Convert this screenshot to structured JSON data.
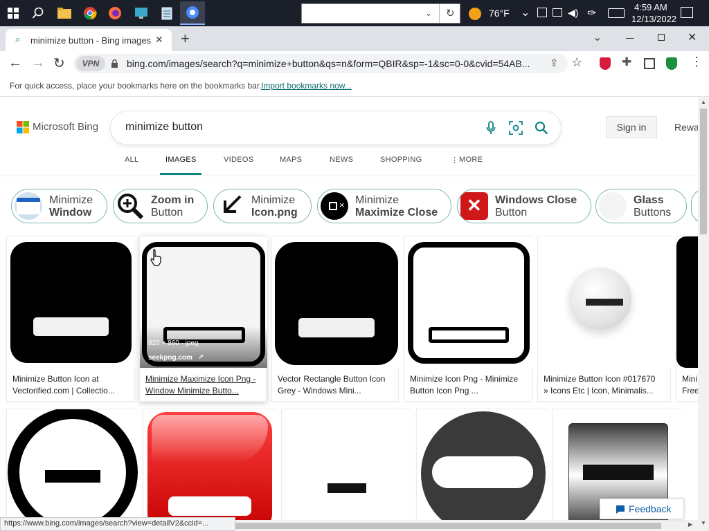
{
  "taskbar": {
    "weather_temp": "76°F",
    "clock_time": "4:59 AM",
    "clock_date": "12/13/2022"
  },
  "browser": {
    "tab_title": "minimize button - Bing images",
    "vpn_label": "VPN",
    "url": "bing.com/images/search?q=minimize+button&qs=n&form=QBIR&sp=-1&sc=0-0&cvid=54AB...",
    "bookmarks_hint": "For quick access, place your bookmarks here on the bookmarks bar.",
    "bookmarks_link": "Import bookmarks now...",
    "status_url": "https://www.bing.com/images/search?view=detailV2&ccid=..."
  },
  "bing": {
    "logo_text": "Microsoft Bing",
    "query": "minimize button",
    "sign_in": "Sign in",
    "rewards": "Rewa",
    "nav_tabs": [
      "ALL",
      "IMAGES",
      "VIDEOS",
      "MAPS",
      "NEWS",
      "SHOPPING",
      "MORE"
    ],
    "active_tab": "IMAGES",
    "feedback": "Feedback",
    "accent_color": "#0c8484"
  },
  "pills": [
    {
      "line1": "Minimize",
      "line2": "Window"
    },
    {
      "line1": "Zoom in",
      "line2": "Button"
    },
    {
      "line1": "Minimize",
      "line2": "Icon.png"
    },
    {
      "line1": "Minimize",
      "line2": "Maximize Close"
    },
    {
      "line1": "Windows Close",
      "line2": "Button"
    },
    {
      "line1": "Glass",
      "line2": "Buttons"
    }
  ],
  "results_row1": [
    {
      "caption": "Minimize Button Icon at Vectorified.com | Collectio..."
    },
    {
      "caption": "Minimize Maximize Icon Png - Window Minimize Butto...",
      "overlay_size": "820 × 860 · jpeg",
      "overlay_source": "seekpng.com"
    },
    {
      "caption": "Vector Rectangle Button Icon Grey - Windows Mini..."
    },
    {
      "caption": "Minimize Icon Png - Minimize Button Icon Png ..."
    },
    {
      "caption": "Minimize Button Icon #017670 » Icons Etc | Icon, Minimalis..."
    },
    {
      "caption": "Mini Free"
    }
  ]
}
